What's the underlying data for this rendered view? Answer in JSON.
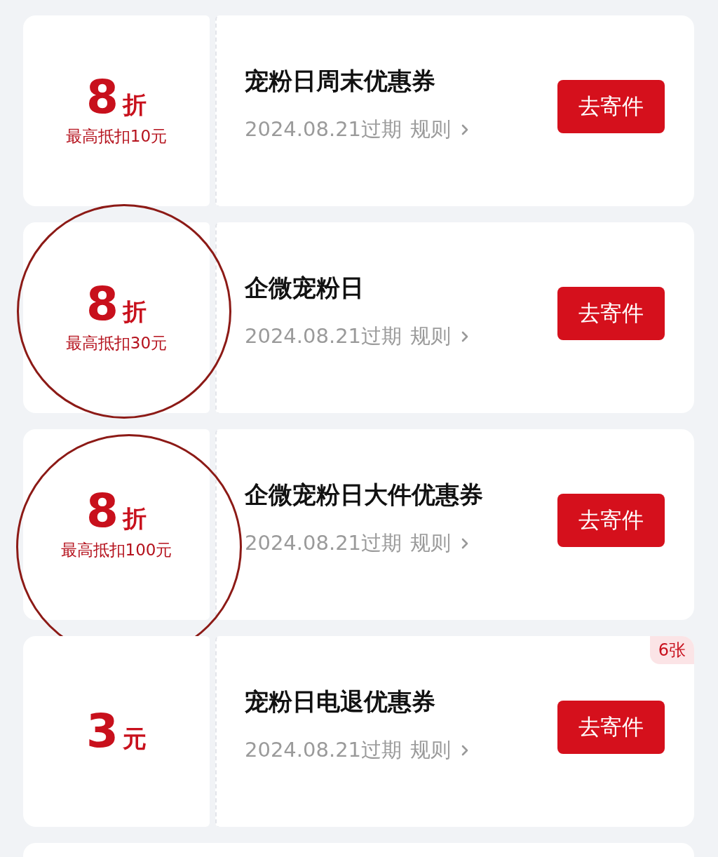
{
  "coupons": [
    {
      "value": "8",
      "unit": "折",
      "limit": "最高抵扣10元",
      "title": "宠粉日周末优惠券",
      "expiry": "2024.08.21过期",
      "rule": "规则",
      "button": "去寄件",
      "circled": false
    },
    {
      "value": "8",
      "unit": "折",
      "limit": "最高抵扣30元",
      "title": "企微宠粉日",
      "expiry": "2024.08.21过期",
      "rule": "规则",
      "button": "去寄件",
      "circled": true
    },
    {
      "value": "8",
      "unit": "折",
      "limit": "最高抵扣100元",
      "title": "企微宠粉日大件优惠券",
      "expiry": "2024.08.21过期",
      "rule": "规则",
      "button": "去寄件",
      "circled": true
    },
    {
      "value": "3",
      "unit": "元",
      "title": "宠粉日电退优惠券",
      "expiry": "2024.08.21过期",
      "rule": "规则",
      "button": "去寄件",
      "badge": "6张",
      "circled": false
    }
  ]
}
